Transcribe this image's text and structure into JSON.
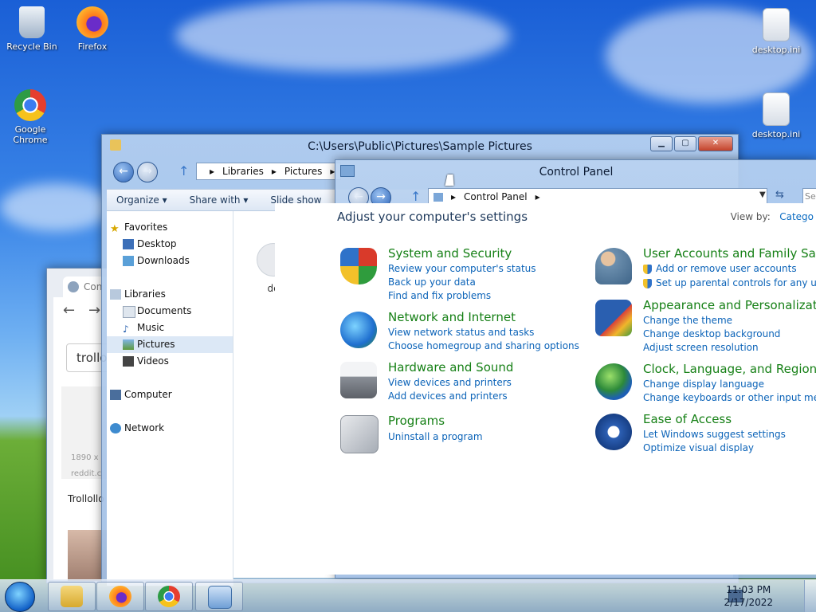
{
  "desktop": {
    "icons": [
      {
        "label": "Recycle Bin",
        "icon": "recycle-bin-icon"
      },
      {
        "label": "Firefox",
        "icon": "firefox-icon"
      },
      {
        "label": "Google Chrome",
        "icon": "chrome-icon"
      },
      {
        "label": "desktop.ini",
        "icon": "ini-file-icon"
      },
      {
        "label": "desktop.ini",
        "icon": "ini-file-icon"
      }
    ]
  },
  "browser": {
    "tab_label": "Con",
    "search_value": "trollo",
    "card_meta": "1890 x",
    "card_source": "reddit.c",
    "card_caption": "Trollollo"
  },
  "explorer": {
    "title": "C:\\Users\\Public\\Pictures\\Sample Pictures",
    "breadcrumb": [
      "Libraries",
      "Pictures",
      "S"
    ],
    "toolbar": [
      "Organize ▾",
      "Share with ▾",
      "Slide show"
    ],
    "nav": {
      "favorites": "Favorites",
      "favorites_items": [
        "Desktop",
        "Downloads"
      ],
      "libraries": "Libraries",
      "libraries_items": [
        "Documents",
        "Music",
        "Pictures",
        "Videos"
      ],
      "computer": "Computer",
      "network": "Network"
    },
    "file_label": "de"
  },
  "control_panel": {
    "title": "Control Panel",
    "breadcrumb": "Control Panel",
    "search_placeholder": "Se",
    "heading": "Adjust your computer's settings",
    "view_by_label": "View by:",
    "view_by_value": "Catego",
    "categories": [
      {
        "title": "System and Security",
        "icon": "shield-icon",
        "links": [
          "Review your computer's status",
          "Back up your data",
          "Find and fix problems"
        ]
      },
      {
        "title": "Network and Internet",
        "icon": "network-globe-icon",
        "links": [
          "View network status and tasks",
          "Choose homegroup and sharing options"
        ]
      },
      {
        "title": "Hardware and Sound",
        "icon": "printer-icon",
        "links": [
          "View devices and printers",
          "Add devices and printers"
        ]
      },
      {
        "title": "Programs",
        "icon": "programs-box-icon",
        "links": [
          "Uninstall a program"
        ]
      },
      {
        "title": "User Accounts and Family Safety",
        "icon": "users-icon",
        "links": [
          "Add or remove user accounts",
          "Set up parental controls for any user"
        ]
      },
      {
        "title": "Appearance and Personalization",
        "icon": "monitor-paint-icon",
        "links": [
          "Change the theme",
          "Change desktop background",
          "Adjust screen resolution"
        ]
      },
      {
        "title": "Clock, Language, and Region",
        "icon": "globe-clock-icon",
        "links": [
          "Change display language",
          "Change keyboards or other input methods"
        ]
      },
      {
        "title": "Ease of Access",
        "icon": "ease-of-access-icon",
        "links": [
          "Let Windows suggest settings",
          "Optimize visual display"
        ]
      }
    ]
  },
  "taskbar": {
    "time": "11:03 PM",
    "date": "2/17/2022"
  }
}
